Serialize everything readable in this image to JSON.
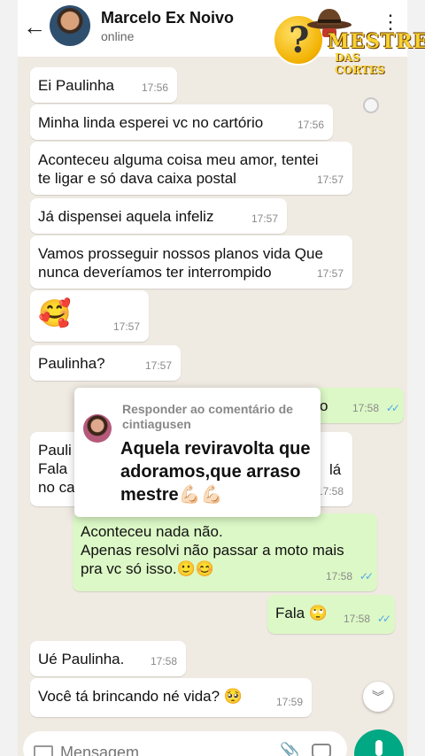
{
  "header": {
    "contact_name": "Marcelo Ex Noivo",
    "status": "online",
    "back_icon": "arrow-left-icon",
    "menu_icon": "kebab-menu-icon"
  },
  "watermark": {
    "line1": "MESTRE",
    "line2": "DAS CORTES",
    "symbol": "?"
  },
  "messages": [
    {
      "dir": "in",
      "text": "Ei Paulinha",
      "time": "17:56"
    },
    {
      "dir": "in",
      "text": "Minha linda esperei vc no cartório",
      "time": "17:56"
    },
    {
      "dir": "in",
      "text": "Aconteceu alguma coisa meu amor, tentei\nte ligar e só dava caixa postal",
      "time": "17:57"
    },
    {
      "dir": "in",
      "text": "Já dispensei aquela infeliz",
      "time": "17:57"
    },
    {
      "dir": "in",
      "text": "Vamos prosseguir nossos planos vida Que\nnunca deveríamos ter interrompido",
      "time": "17:57"
    },
    {
      "dir": "in",
      "text": "🥰",
      "time": "17:57"
    },
    {
      "dir": "in",
      "text": "Paulinha?",
      "time": "17:57"
    },
    {
      "dir": "out",
      "text": "o",
      "time": "17:58"
    },
    {
      "dir": "in",
      "text": "Pauli\nFala \nno ca",
      "extra": "lá",
      "time": "17:58"
    },
    {
      "dir": "out",
      "text": "Aconteceu nada não.\nApenas resolvi não passar a moto mais\npra vc só isso.🙂😊",
      "time": "17:58"
    },
    {
      "dir": "out",
      "text": "Fala 🙄",
      "time": "17:58"
    },
    {
      "dir": "in",
      "text": "Ué Paulinha.",
      "time": "17:58"
    },
    {
      "dir": "in",
      "text": "Você tá brincando né vida? 🥺",
      "time": "17:59"
    }
  ],
  "comment_overlay": {
    "header": "Responder ao comentário de cintiagusen",
    "body": "Aquela reviravolta que adoramos,que arraso mestre💪🏻💪🏻"
  },
  "composer": {
    "placeholder": "Mensagem"
  },
  "colors": {
    "incoming": "#ffffff",
    "outgoing": "#dcf8c6",
    "chat_bg": "#efeae2",
    "accent": "#00a884",
    "read_ticks": "#4fa9e8"
  }
}
